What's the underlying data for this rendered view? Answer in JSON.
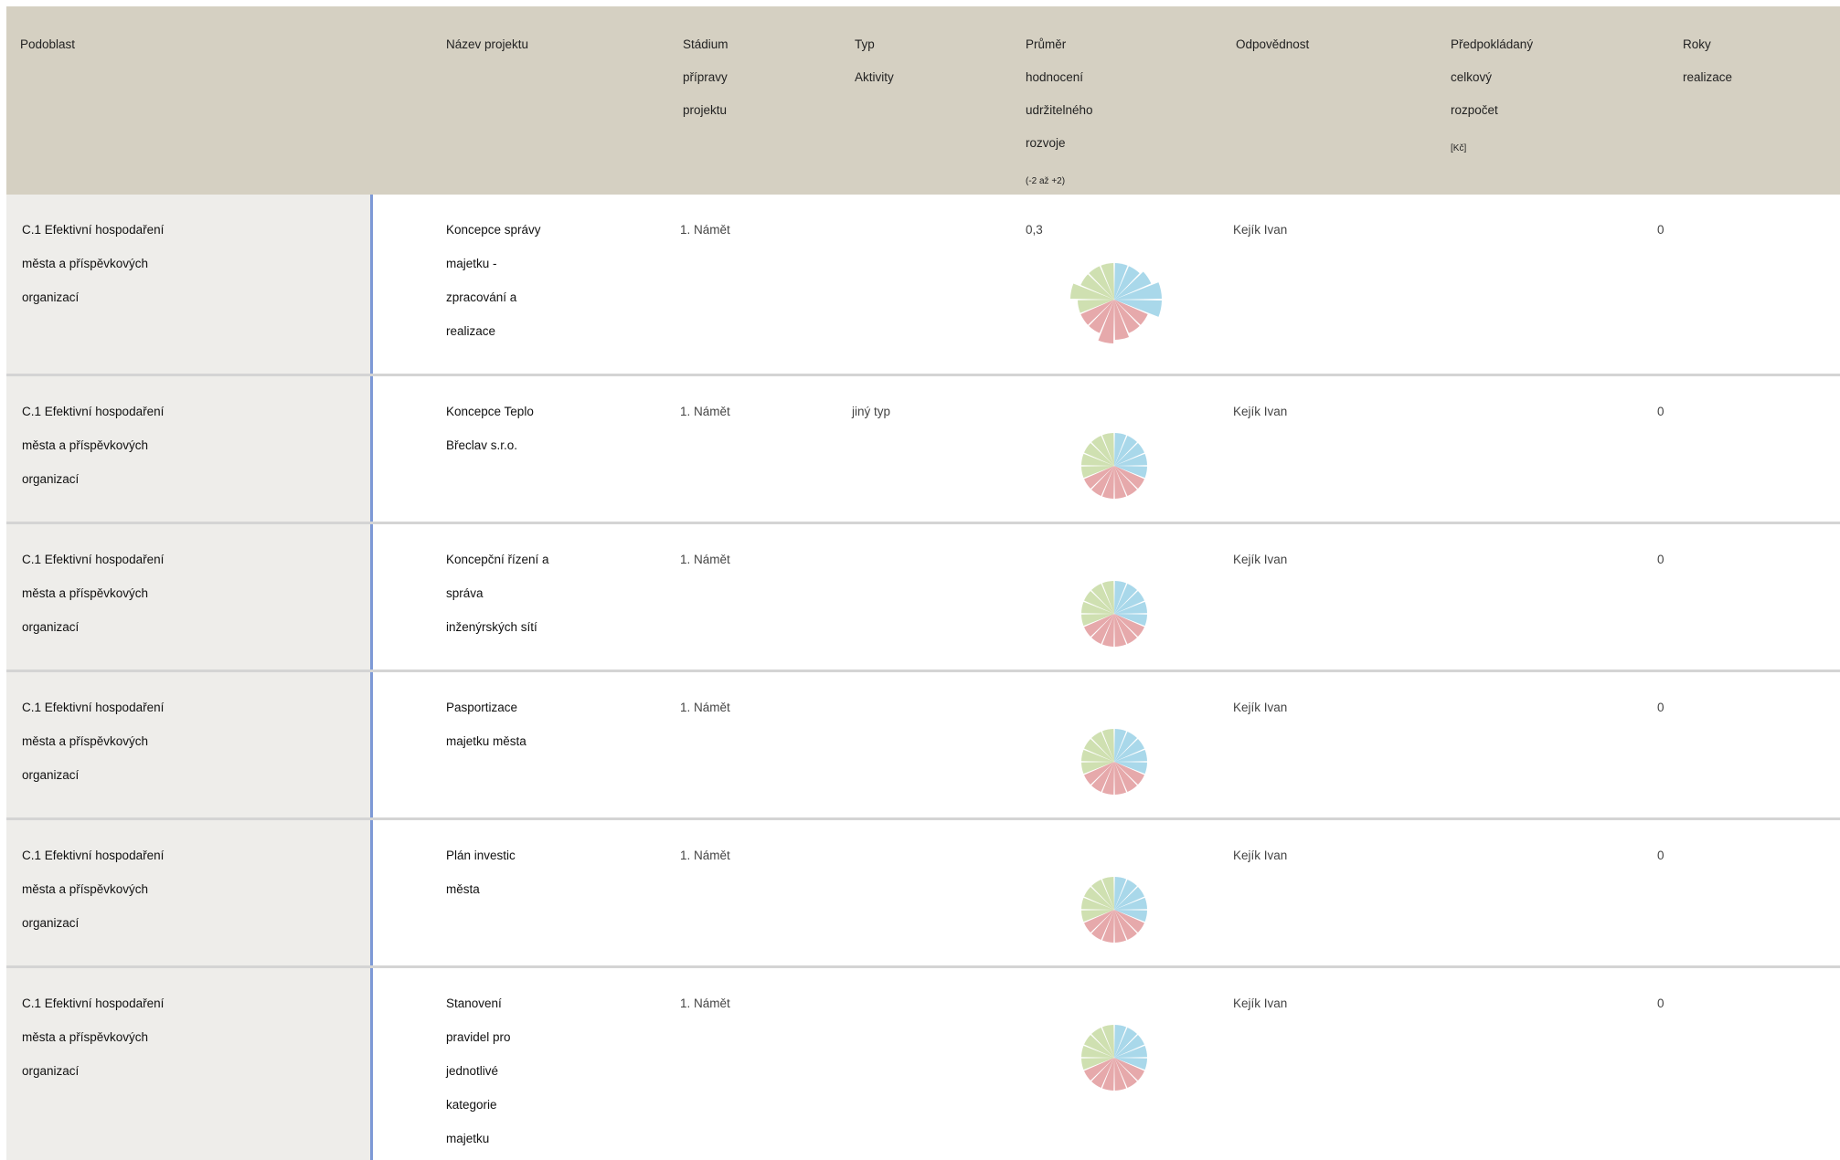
{
  "header": {
    "columns": [
      {
        "key": "podoblast",
        "lines": [
          "Podoblast"
        ]
      },
      {
        "key": "nazev",
        "lines": [
          "Název projektu"
        ]
      },
      {
        "key": "stadium",
        "lines": [
          "Stádium",
          "přípravy",
          "projektu"
        ]
      },
      {
        "key": "typ",
        "lines": [
          "Typ",
          "Aktivity"
        ]
      },
      {
        "key": "prumer",
        "lines": [
          "Průměr",
          "hodnocení",
          "udržitelného",
          "rozvoje"
        ],
        "note": "(-2 až +2)"
      },
      {
        "key": "odpovednost",
        "lines": [
          "Odpovědnost"
        ]
      },
      {
        "key": "rozpocet",
        "lines": [
          "Předpokládaný",
          "celkový",
          "rozpočet"
        ],
        "note": "[Kč]"
      },
      {
        "key": "roky",
        "lines": [
          "Roky",
          "realizace"
        ]
      }
    ]
  },
  "rows": [
    {
      "podoblast": [
        "C.1 Efektivní hospodaření",
        "města a příspěvkových",
        "organizací"
      ],
      "nazev": [
        "Koncepce správy",
        "majetku -",
        "zpracování a",
        "realizace"
      ],
      "stadium": "1. Námět",
      "typ": "",
      "prumer": "0,3",
      "odpovednost": "Kejík Ivan",
      "rozpocet": "",
      "roky": "0",
      "rose_scores": [
        0.5,
        0.5,
        1,
        2,
        2,
        0.5,
        0.5,
        1,
        1.5,
        0.5,
        0.5,
        0.5,
        1.5,
        0.5,
        0.5,
        0.5
      ]
    },
    {
      "podoblast": [
        "C.1 Efektivní hospodaření",
        "města a příspěvkových",
        "organizací"
      ],
      "nazev": [
        "Koncepce Teplo",
        "Břeclav s.r.o."
      ],
      "stadium": "1. Námět",
      "typ": "jiný typ",
      "prumer": "",
      "odpovednost": "Kejík Ivan",
      "rozpocet": "",
      "roky": "0",
      "rose_scores": [
        0,
        0,
        0,
        0,
        0,
        0,
        0,
        0,
        0,
        0,
        0,
        0,
        0,
        0,
        0,
        0
      ]
    },
    {
      "podoblast": [
        "C.1 Efektivní hospodaření",
        "města a příspěvkových",
        "organizací"
      ],
      "nazev": [
        "Koncepční řízení a",
        "správa",
        "inženýrských sítí"
      ],
      "stadium": "1. Námět",
      "typ": "",
      "prumer": "",
      "odpovednost": "Kejík Ivan",
      "rozpocet": "",
      "roky": "0",
      "rose_scores": [
        0,
        0,
        0,
        0,
        0,
        0,
        0,
        0,
        0,
        0,
        0,
        0,
        0,
        0,
        0,
        0
      ]
    },
    {
      "podoblast": [
        "C.1 Efektivní hospodaření",
        "města a příspěvkových",
        "organizací"
      ],
      "nazev": [
        "Pasportizace",
        "majetku města"
      ],
      "stadium": "1. Námět",
      "typ": "",
      "prumer": "",
      "odpovednost": "Kejík Ivan",
      "rozpocet": "",
      "roky": "0",
      "rose_scores": [
        0,
        0,
        0,
        0,
        0,
        0,
        0,
        0,
        0,
        0,
        0,
        0,
        0,
        0,
        0,
        0
      ]
    },
    {
      "podoblast": [
        "C.1 Efektivní hospodaření",
        "města a příspěvkových",
        "organizací"
      ],
      "nazev": [
        "Plán investic",
        "města"
      ],
      "stadium": "1. Námět",
      "typ": "",
      "prumer": "",
      "odpovednost": "Kejík Ivan",
      "rozpocet": "",
      "roky": "0",
      "rose_scores": [
        0,
        0,
        0,
        0,
        0,
        0,
        0,
        0,
        0,
        0,
        0,
        0,
        0,
        0,
        0,
        0
      ]
    },
    {
      "podoblast": [
        "C.1 Efektivní hospodaření",
        "města a příspěvkových",
        "organizací"
      ],
      "nazev": [
        "Stanovení",
        "pravidel pro",
        "jednotlivé",
        "kategorie",
        "majetku"
      ],
      "stadium": "1. Námět",
      "typ": "",
      "prumer": "",
      "odpovednost": "Kejík Ivan",
      "rozpocet": "",
      "roky": "0",
      "rose_scores": [
        0,
        0,
        0,
        0,
        0,
        0,
        0,
        0,
        0,
        0,
        0,
        0,
        0,
        0,
        0,
        0
      ]
    }
  ],
  "rose_colors": {
    "blue": "#a9d8ea",
    "red": "#e6a9ab",
    "green": "#cfe0b1"
  }
}
